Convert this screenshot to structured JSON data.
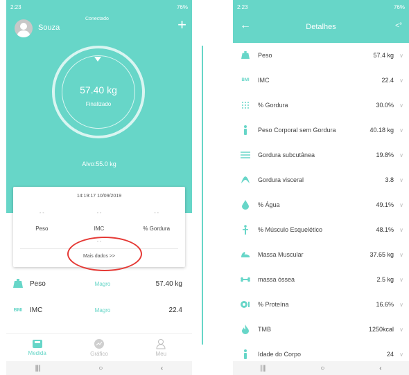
{
  "accent_color": "#67d6c8",
  "highlight_color": "#e53935",
  "left": {
    "status_time": "2:23",
    "status_right": "76%",
    "user_name": "Souza",
    "connection_status": "Conectado",
    "weight": "57.40 kg",
    "weight_status": "Finalizado",
    "goal": "Alvo:55.0 kg",
    "timestamp": "14:19:17 10/09/2019",
    "card_placeholder": "- -",
    "card_labels": [
      "Peso",
      "IMC",
      "% Gordura"
    ],
    "more_data": "Mais dados >>",
    "metrics": [
      {
        "icon": "scale-icon",
        "name": "Peso",
        "category": "Magro",
        "value": "57.40 kg"
      },
      {
        "icon": "bmi-icon",
        "name": "IMC",
        "category": "Magro",
        "value": "22.4"
      }
    ],
    "bmi_icon_text": "BMI",
    "bottom_nav": [
      {
        "icon": "scale-nav-icon",
        "label": "Medida"
      },
      {
        "icon": "chart-icon",
        "label": "Gráfico"
      },
      {
        "icon": "person-icon",
        "label": "Meu"
      }
    ]
  },
  "right": {
    "status_time": "2:23",
    "status_right": "76%",
    "title": "Detalhes",
    "bmi_icon_text": "BMI",
    "rows": [
      {
        "icon": "scale-icon",
        "name": "Peso",
        "value": "57.4 kg"
      },
      {
        "icon": "bmi-icon",
        "name": "IMC",
        "value": "22.4"
      },
      {
        "icon": "fat-icon",
        "name": "% Gordura",
        "value": "30.0%"
      },
      {
        "icon": "lean-body-icon",
        "name": "Peso Corporal sem Gordura",
        "value": "40.18 kg"
      },
      {
        "icon": "subcutaneous-fat-icon",
        "name": "Gordura subcutânea",
        "value": "19.8%"
      },
      {
        "icon": "visceral-fat-icon",
        "name": "Gordura visceral",
        "value": "3.8"
      },
      {
        "icon": "water-drop-icon",
        "name": "% Água",
        "value": "49.1%"
      },
      {
        "icon": "skeletal-muscle-icon",
        "name": "% Músculo Esquelético",
        "value": "48.1%"
      },
      {
        "icon": "muscle-icon",
        "name": "Massa Muscular",
        "value": "37.65 kg"
      },
      {
        "icon": "bone-icon",
        "name": "massa óssea",
        "value": "2.5 kg"
      },
      {
        "icon": "protein-icon",
        "name": "% Proteína",
        "value": "16.6%"
      },
      {
        "icon": "bmr-flame-icon",
        "name": "TMB",
        "value": "1250kcal"
      },
      {
        "icon": "body-age-icon",
        "name": "Idade do Corpo",
        "value": "24"
      }
    ]
  }
}
